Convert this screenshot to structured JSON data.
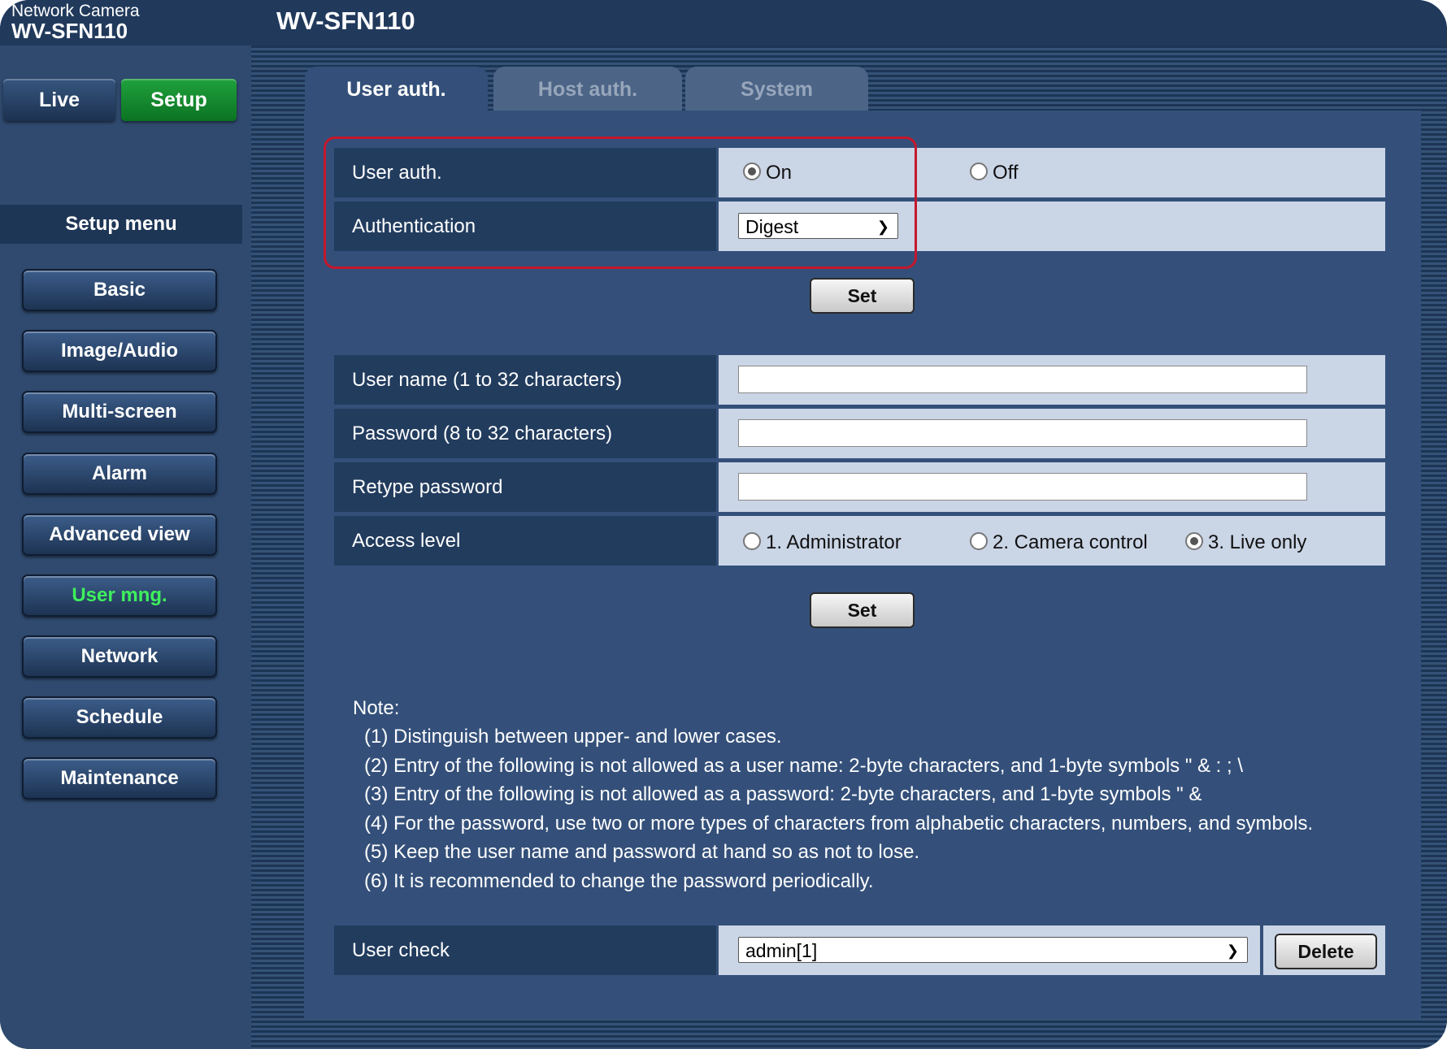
{
  "header": {
    "brand_line1": "Network Camera",
    "brand_line2": "WV-SFN110",
    "model_title": "WV-SFN110"
  },
  "sidebar": {
    "live_label": "Live",
    "setup_label": "Setup",
    "menu_title": "Setup menu",
    "items": [
      {
        "label": "Basic",
        "active": false
      },
      {
        "label": "Image/Audio",
        "active": false
      },
      {
        "label": "Multi-screen",
        "active": false
      },
      {
        "label": "Alarm",
        "active": false
      },
      {
        "label": "Advanced view",
        "active": false
      },
      {
        "label": "User mng.",
        "active": true
      },
      {
        "label": "Network",
        "active": false
      },
      {
        "label": "Schedule",
        "active": false
      },
      {
        "label": "Maintenance",
        "active": false
      }
    ]
  },
  "tabs": [
    {
      "label": "User auth.",
      "active": true
    },
    {
      "label": "Host auth.",
      "active": false
    },
    {
      "label": "System",
      "active": false
    }
  ],
  "auth_section": {
    "user_auth_label": "User auth.",
    "on_label": "On",
    "off_label": "Off",
    "selected": "On",
    "authentication_label": "Authentication",
    "authentication_value": "Digest",
    "set_label": "Set"
  },
  "user_section": {
    "username_label": "User name (1 to 32 characters)",
    "username_value": "",
    "password_label": "Password (8 to 32 characters)",
    "password_value": "",
    "retype_label": "Retype password",
    "retype_value": "",
    "access_level_label": "Access level",
    "access_options": [
      "1. Administrator",
      "2. Camera control",
      "3. Live only"
    ],
    "access_selected": "3. Live only",
    "set_label": "Set"
  },
  "notes": {
    "title": "Note:",
    "lines": [
      "(1) Distinguish between upper- and lower cases.",
      "(2) Entry of the following is not allowed as a user name:   2-byte characters, and 1-byte symbols \" & : ; \\",
      "(3) Entry of the following is not allowed as a password:   2-byte characters, and 1-byte symbols \" &",
      "(4) For the password, use two or more types of characters from alphabetic characters, numbers, and symbols.",
      "(5) Keep the user name and password at hand so as not to lose.",
      "(6) It is recommended to change the password periodically."
    ]
  },
  "user_check": {
    "label": "User check",
    "selected_user": "admin[1]",
    "delete_label": "Delete"
  },
  "colors": {
    "highlight": "#c5182c",
    "active_menu_text": "#3ef05c",
    "setup_button": "#139130"
  }
}
